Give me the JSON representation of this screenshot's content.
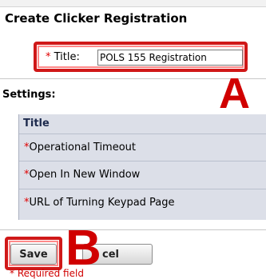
{
  "page_title": "Create Clicker Registration",
  "required_marker": "*",
  "title_field": {
    "label": "Title:",
    "value": "POLS 155 Registration"
  },
  "settings": {
    "heading": "Settings:",
    "column_header": "Title",
    "rows": [
      {
        "label": "Operational Timeout"
      },
      {
        "label": "Open In New Window"
      },
      {
        "label": "URL of Turning Keypad Page"
      }
    ]
  },
  "buttons": {
    "save_label": "Save",
    "cancel_label": "cel"
  },
  "annotations": {
    "a": "A",
    "b": "B"
  },
  "footer_note": "* Required field",
  "colors": {
    "highlight": "#d01818",
    "required": "#e00000",
    "table_bg": "#dcdfe8"
  }
}
